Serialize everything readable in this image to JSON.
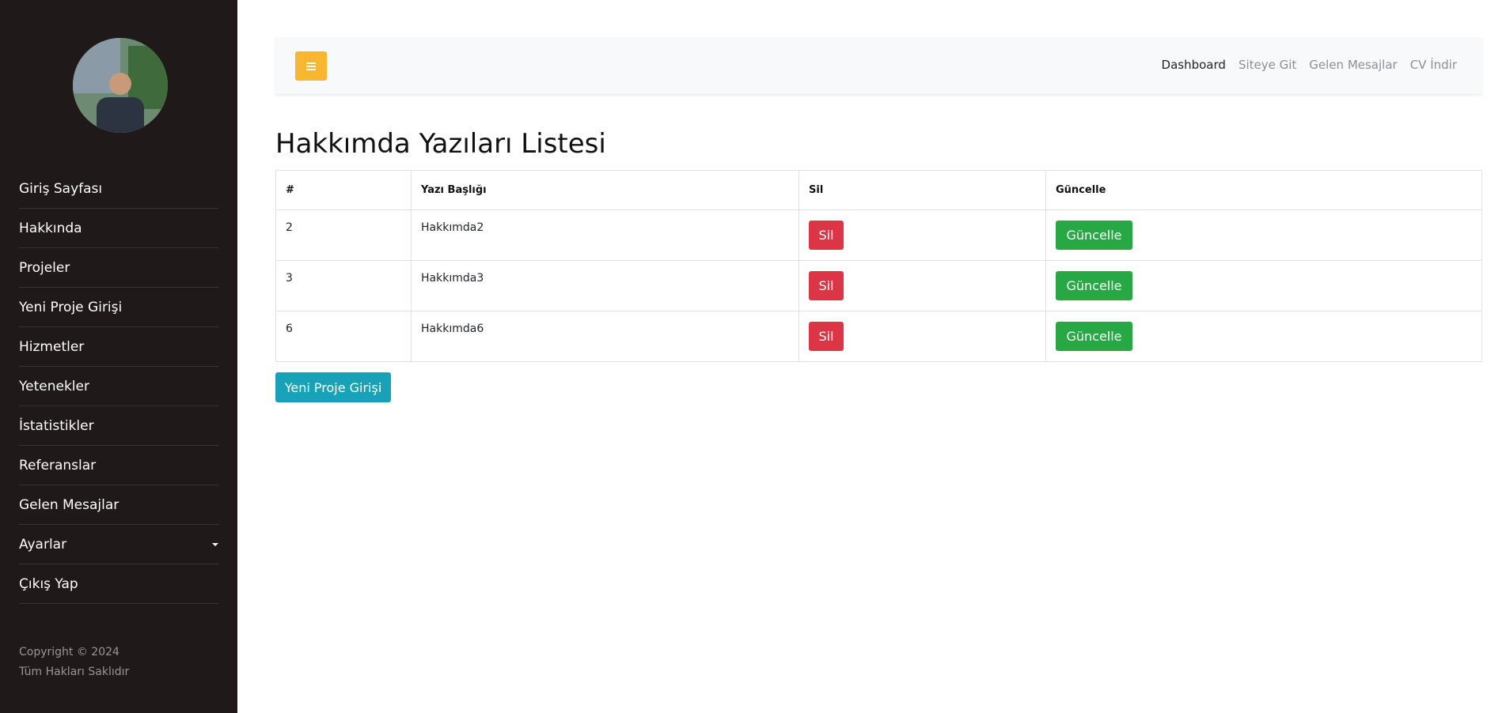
{
  "sidebar": {
    "avatar_alt": "profile photo",
    "items": [
      {
        "label": "Giriş Sayfası"
      },
      {
        "label": "Hakkında"
      },
      {
        "label": "Projeler"
      },
      {
        "label": "Yeni Proje Girişi"
      },
      {
        "label": "Hizmetler"
      },
      {
        "label": "Yetenekler"
      },
      {
        "label": "İstatistikler"
      },
      {
        "label": "Referanslar"
      },
      {
        "label": "Gelen Mesajlar"
      },
      {
        "label": "Ayarlar",
        "has_dropdown": true
      },
      {
        "label": "Çıkış Yap"
      }
    ],
    "footer": {
      "copyright": "Copyright © 2024",
      "rights": "Tüm Hakları Saklıdır"
    }
  },
  "topbar": {
    "toggle_icon": "hamburger-icon",
    "links": [
      {
        "label": "Dashboard",
        "active": true
      },
      {
        "label": "Siteye Git"
      },
      {
        "label": "Gelen Mesajlar"
      },
      {
        "label": "CV İndir"
      }
    ]
  },
  "main": {
    "title": "Hakkımda Yazıları Listesi",
    "table": {
      "headers": [
        "#",
        "Yazı Başlığı",
        "Sil",
        "Güncelle"
      ],
      "rows": [
        {
          "id": "2",
          "title": "Hakkımda2",
          "delete_label": "Sil",
          "update_label": "Güncelle"
        },
        {
          "id": "3",
          "title": "Hakkımda3",
          "delete_label": "Sil",
          "update_label": "Güncelle"
        },
        {
          "id": "6",
          "title": "Hakkımda6",
          "delete_label": "Sil",
          "update_label": "Güncelle"
        }
      ]
    },
    "new_button_label": "Yeni Proje Girişi"
  },
  "colors": {
    "sidebar_bg": "#1f1a19",
    "toggle": "#f7b731",
    "danger": "#dc3545",
    "success": "#28a745",
    "info": "#17a2b8"
  }
}
